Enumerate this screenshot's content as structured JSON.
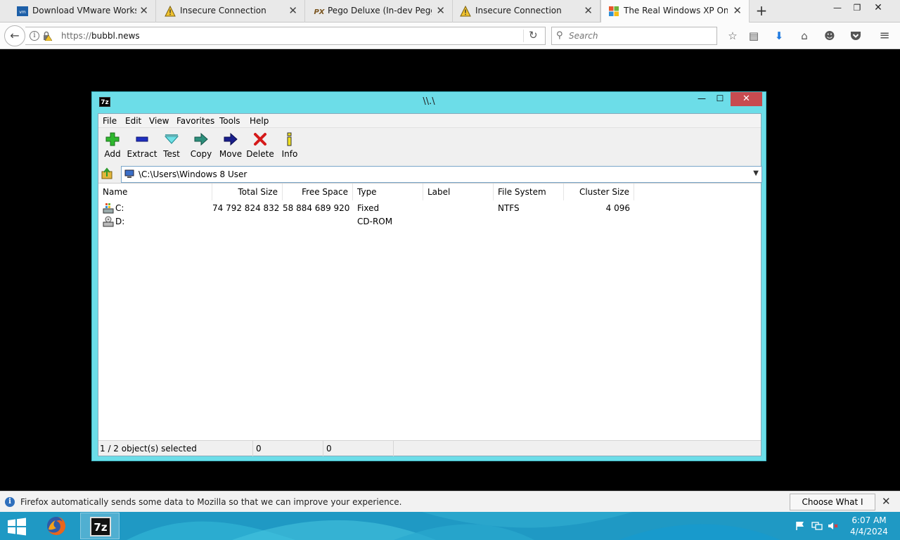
{
  "browser": {
    "tabs": [
      {
        "title": "Download VMware Works...",
        "icon": "vmware-icon"
      },
      {
        "title": "Insecure Connection",
        "icon": "warning-icon"
      },
      {
        "title": "Pego Deluxe (In-dev Peggl...",
        "icon": "pego-icon"
      },
      {
        "title": "Insecure Connection",
        "icon": "warning-icon"
      },
      {
        "title": "The Real Windows XP Onli...",
        "icon": "windows-xp-icon"
      }
    ],
    "url_prefix": "https://",
    "url_host": "bubbl.news",
    "search_placeholder": "Search"
  },
  "sevenzip": {
    "title": "\\\\.\\",
    "menu": [
      "File",
      "Edit",
      "View",
      "Favorites",
      "Tools",
      "Help"
    ],
    "toolbar": [
      "Add",
      "Extract",
      "Test",
      "Copy",
      "Move",
      "Delete",
      "Info"
    ],
    "path": "\\C:\\Users\\Windows 8 User",
    "columns": [
      "Name",
      "Total Size",
      "Free Space",
      "Type",
      "Label",
      "File System",
      "Cluster Size"
    ],
    "rows": [
      {
        "name": "C:",
        "total_size": "74 792 824 832",
        "free_space": "58 884 689 920",
        "type": "Fixed",
        "label": "",
        "file_system": "NTFS",
        "cluster_size": "4 096"
      },
      {
        "name": "D:",
        "total_size": "",
        "free_space": "",
        "type": "CD-ROM",
        "label": "",
        "file_system": "",
        "cluster_size": ""
      }
    ],
    "status": [
      "1 / 2 object(s) selected",
      "0",
      "0"
    ]
  },
  "notification": {
    "message": "Firefox automatically sends some data to Mozilla so that we can improve your experience.",
    "button": "Choose What I Share"
  },
  "taskbar": {
    "time": "6:07 AM",
    "date": "4/4/2024"
  },
  "colors": {
    "window_frame": "#6cdde8",
    "close_button": "#c74b50",
    "taskbar": "#1f99c4"
  }
}
